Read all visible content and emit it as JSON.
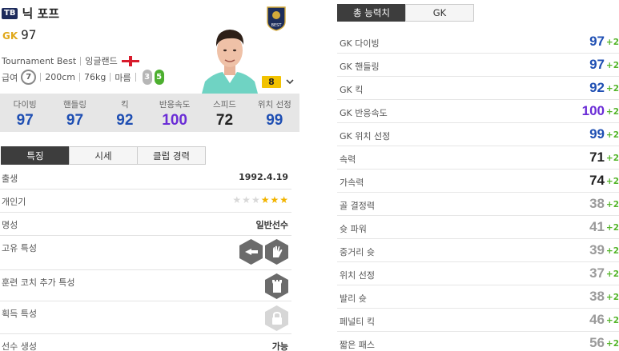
{
  "player": {
    "season_badge": "TB",
    "name": "닉 포프",
    "position": "GK",
    "ovr": "97",
    "season_name": "Tournament Best",
    "nation": "잉글랜드",
    "pay_label": "급여",
    "pay": "7",
    "height": "200cm",
    "weight": "76kg",
    "body_type": "마름",
    "foot_left": "3",
    "foot_right": "5",
    "upgrade_level": "8",
    "club_logo_text": "BEST"
  },
  "top_stats": [
    {
      "label": "다이빙",
      "value": "97",
      "color": "#1f4fb3"
    },
    {
      "label": "핸들링",
      "value": "97",
      "color": "#1f4fb3"
    },
    {
      "label": "킥",
      "value": "92",
      "color": "#1f4fb3"
    },
    {
      "label": "반응속도",
      "value": "100",
      "color": "#6a2cd6"
    },
    {
      "label": "스피드",
      "value": "72",
      "color": "#222222"
    },
    {
      "label": "위치 선정",
      "value": "99",
      "color": "#1f4fb3"
    }
  ],
  "left_tabs": [
    {
      "label": "특징",
      "active": true
    },
    {
      "label": "시세",
      "active": false
    },
    {
      "label": "클럽 경력",
      "active": false
    }
  ],
  "info": {
    "birth_label": "출생",
    "birth_value": "1992.4.19",
    "popularity_label": "개인기",
    "popularity_stars_filled": 3,
    "popularity_stars_total": 6,
    "reputation_label": "명성",
    "reputation_value": "일반선수",
    "unique_traits_label": "고유 특성",
    "coach_traits_label": "훈련 코치 추가 특성",
    "acquired_traits_label": "획득 특성",
    "creation_label": "선수 생성",
    "creation_value": "가능"
  },
  "right_tabs": [
    {
      "label": "총 능력치",
      "active": true
    },
    {
      "label": "GK",
      "active": false
    }
  ],
  "attributes": [
    {
      "label": "GK 다이빙",
      "value": "97",
      "plus": "+2",
      "color": "#1f4fb3"
    },
    {
      "label": "GK 핸들링",
      "value": "97",
      "plus": "+2",
      "color": "#1f4fb3"
    },
    {
      "label": "GK 킥",
      "value": "92",
      "plus": "+2",
      "color": "#1f4fb3"
    },
    {
      "label": "GK 반응속도",
      "value": "100",
      "plus": "+2",
      "color": "#6a2cd6"
    },
    {
      "label": "GK 위치 선정",
      "value": "99",
      "plus": "+2",
      "color": "#1f4fb3"
    },
    {
      "label": "속력",
      "value": "71",
      "plus": "+2",
      "color": "#222222"
    },
    {
      "label": "가속력",
      "value": "74",
      "plus": "+2",
      "color": "#222222"
    },
    {
      "label": "골 결정력",
      "value": "38",
      "plus": "+2",
      "color": "#9a9a9a"
    },
    {
      "label": "슛 파워",
      "value": "41",
      "plus": "+2",
      "color": "#9a9a9a"
    },
    {
      "label": "중거리 슛",
      "value": "39",
      "plus": "+2",
      "color": "#9a9a9a"
    },
    {
      "label": "위치 선정",
      "value": "37",
      "plus": "+2",
      "color": "#9a9a9a"
    },
    {
      "label": "발리 슛",
      "value": "38",
      "plus": "+2",
      "color": "#9a9a9a"
    },
    {
      "label": "페널티 킥",
      "value": "46",
      "plus": "+2",
      "color": "#9a9a9a"
    },
    {
      "label": "짧은 패스",
      "value": "56",
      "plus": "+2",
      "color": "#9a9a9a"
    }
  ]
}
